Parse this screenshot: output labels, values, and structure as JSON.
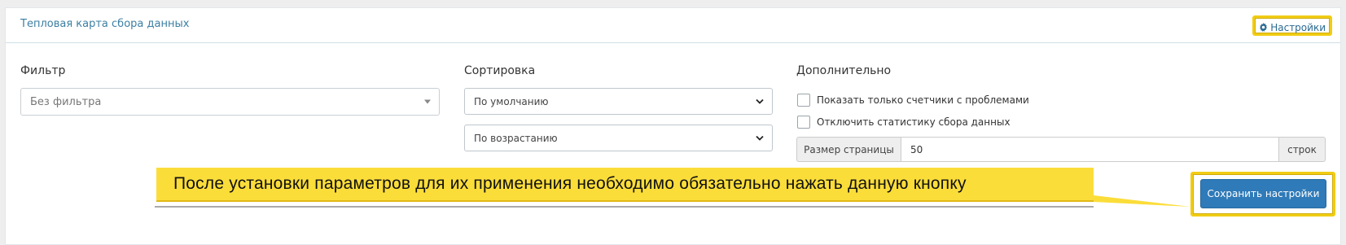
{
  "panel": {
    "title": "Тепловая карта сбора данных",
    "settings_label": "Настройки"
  },
  "filter": {
    "label": "Фильтр",
    "value": "Без фильтра"
  },
  "sort": {
    "label": "Сортировка",
    "field_value": "По умолчанию",
    "order_value": "По возрастанию"
  },
  "extra": {
    "label": "Дополнительно",
    "only_problems_label": "Показать только счетчики с проблемами",
    "disable_stats_label": "Отключить статистику сбора данных",
    "page_size_label": "Размер страницы",
    "page_size_value": "50",
    "page_size_unit": "строк"
  },
  "callout": {
    "text": "После установки параметров для их применения необходимо обязательно нажать данную кнопку"
  },
  "save_button_label": "Сохранить настройки",
  "colors": {
    "accent": "#2f7ab8",
    "highlight": "#fbdd3a",
    "title": "#3c7fa3"
  }
}
